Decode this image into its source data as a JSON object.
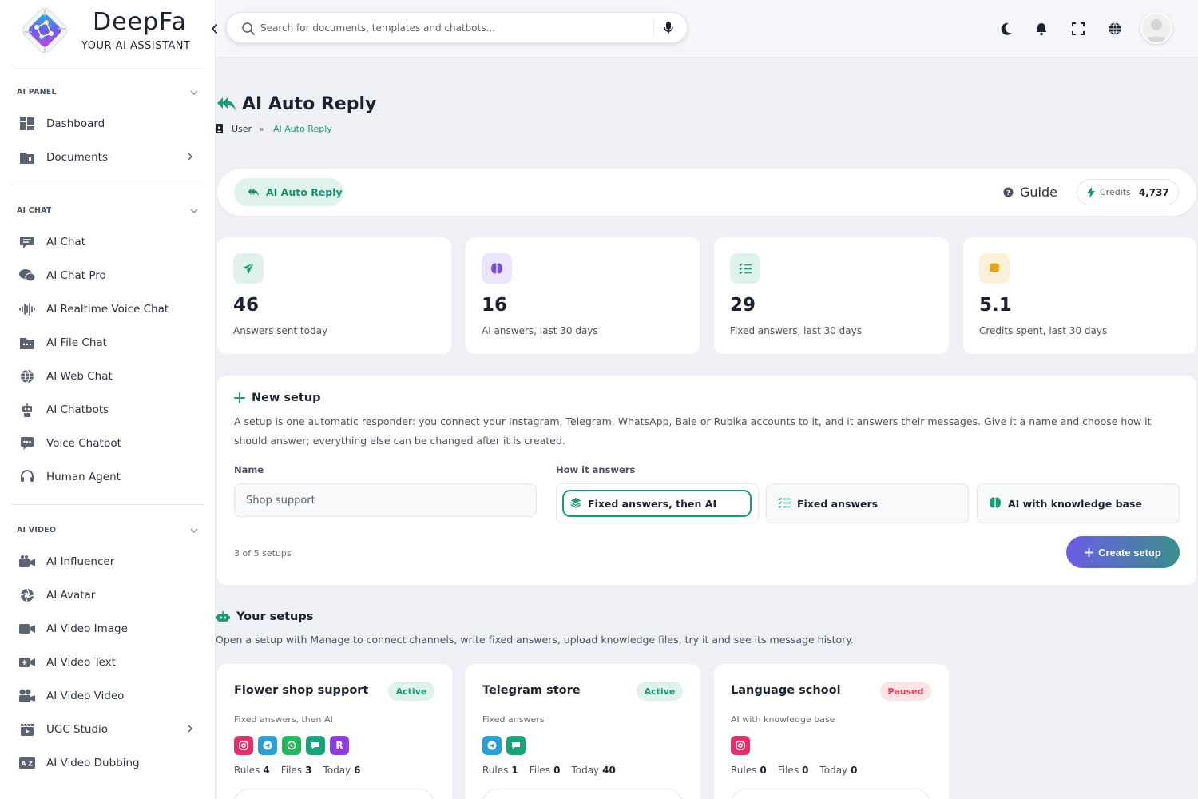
{
  "brand": {
    "name": "DeepFa",
    "tagline": "YOUR AI ASSISTANT"
  },
  "sidebar": {
    "sections": [
      {
        "title": "AI PANEL",
        "items": [
          {
            "label": "Dashboard",
            "icon": "dashboard-icon",
            "has_submenu": false
          },
          {
            "label": "Documents",
            "icon": "folder-icon",
            "has_submenu": true
          }
        ]
      },
      {
        "title": "AI CHAT",
        "items": [
          {
            "label": "AI Chat",
            "icon": "chat-message-icon",
            "has_submenu": false
          },
          {
            "label": "AI Chat Pro",
            "icon": "chat-bubbles-icon",
            "has_submenu": false
          },
          {
            "label": "AI Realtime Voice Chat",
            "icon": "soundwave-icon",
            "has_submenu": false
          },
          {
            "label": "AI File Chat",
            "icon": "file-folder-icon",
            "has_submenu": false
          },
          {
            "label": "AI Web Chat",
            "icon": "globe-icon",
            "has_submenu": false
          },
          {
            "label": "AI Chatbots",
            "icon": "robot-icon",
            "has_submenu": false
          },
          {
            "label": "Voice Chatbot",
            "icon": "voice-chat-icon",
            "has_submenu": false
          },
          {
            "label": "Human Agent",
            "icon": "headset-icon",
            "has_submenu": false
          }
        ]
      },
      {
        "title": "AI VIDEO",
        "items": [
          {
            "label": "AI Influencer",
            "icon": "influencer-icon",
            "has_submenu": false
          },
          {
            "label": "AI Avatar",
            "icon": "avatar-aperture-icon",
            "has_submenu": false
          },
          {
            "label": "AI Video Image",
            "icon": "video-camera-icon",
            "has_submenu": false
          },
          {
            "label": "AI Video Text",
            "icon": "video-plus-icon",
            "has_submenu": false
          },
          {
            "label": "AI Video Video",
            "icon": "film-camera-icon",
            "has_submenu": false
          },
          {
            "label": "UGC Studio",
            "icon": "clapperboard-icon",
            "has_submenu": true
          },
          {
            "label": "AI Video Dubbing",
            "icon": "dubbing-icon",
            "has_submenu": false
          }
        ]
      }
    ]
  },
  "topbar": {
    "search_placeholder": "Search for documents, templates and chatbots...",
    "icons": [
      "moon-icon",
      "bell-icon",
      "fullscreen-icon",
      "globe-icon"
    ]
  },
  "page": {
    "title": "AI Auto Reply",
    "breadcrumb": {
      "root": "User",
      "separator": "»",
      "current": "AI Auto Reply"
    }
  },
  "header": {
    "tab_label": "AI Auto Reply",
    "guide_label": "Guide",
    "credits_label": "Credits",
    "credits_value": "4,737"
  },
  "stats": [
    {
      "value": "46",
      "label": "Answers sent today",
      "icon": "paper-plane-icon",
      "color": "#1a9a78",
      "bg": "#dff3ec"
    },
    {
      "value": "16",
      "label": "AI answers, last 30 days",
      "icon": "brain-icon",
      "color": "#7c4ddb",
      "bg": "#ece4fb"
    },
    {
      "value": "29",
      "label": "Fixed answers, last 30 days",
      "icon": "checklist-icon",
      "color": "#1a9a78",
      "bg": "#dff3ec"
    },
    {
      "value": "5.1",
      "label": "Credits spent, last 30 days",
      "icon": "coins-icon",
      "color": "#e8a317",
      "bg": "#fdf0d9"
    }
  ],
  "new_setup": {
    "title": "New setup",
    "description": "A setup is one automatic responder: you connect your Instagram, Telegram, WhatsApp, Bale or Rubika accounts to it, and it answers their messages. Give it a name and choose how it should answer; everything else can be changed after it is created.",
    "name_label": "Name",
    "name_placeholder": "Shop support",
    "mode_label": "How it answers",
    "modes": [
      {
        "label": "Fixed answers, then AI",
        "icon": "layers-icon",
        "selected": true
      },
      {
        "label": "Fixed answers",
        "icon": "checklist-icon",
        "selected": false
      },
      {
        "label": "AI with knowledge base",
        "icon": "brain-icon",
        "selected": false
      }
    ],
    "count_text": "3 of 5 setups",
    "create_label": "Create setup"
  },
  "your_setups": {
    "title": "Your setups",
    "description": "Open a setup with Manage to connect channels, write fixed answers, upload knowledge files, try it and see its message history.",
    "stat_labels": {
      "rules": "Rules",
      "files": "Files",
      "today": "Today"
    },
    "items": [
      {
        "name": "Flower shop support",
        "status": "Active",
        "mode": "Fixed answers, then AI",
        "channels": [
          "instagram",
          "telegram",
          "whatsapp",
          "bale",
          "rubika"
        ],
        "rules": "4",
        "files": "3",
        "today": "6"
      },
      {
        "name": "Telegram store",
        "status": "Active",
        "mode": "Fixed answers",
        "channels": [
          "telegram",
          "bale"
        ],
        "rules": "1",
        "files": "0",
        "today": "40"
      },
      {
        "name": "Language school",
        "status": "Paused",
        "mode": "AI with knowledge base",
        "channels": [
          "instagram"
        ],
        "rules": "0",
        "files": "0",
        "today": "0"
      }
    ]
  },
  "colors": {
    "accent": "#1a9a78",
    "instagram": "#e1306c",
    "telegram": "#2a9fd6",
    "whatsapp": "#25b85a",
    "bale": "#1aa37a",
    "rubika": "#8b3dd9"
  }
}
